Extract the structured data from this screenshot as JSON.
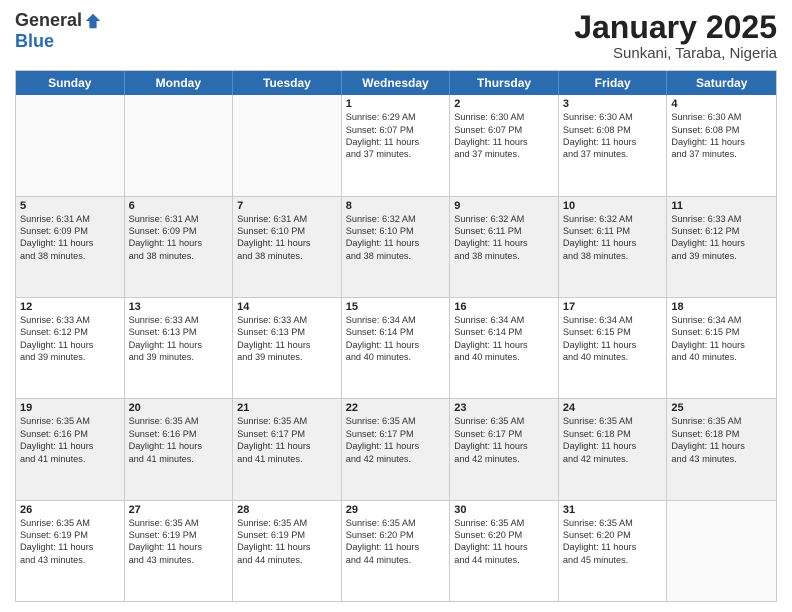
{
  "logo": {
    "general": "General",
    "blue": "Blue"
  },
  "title": "January 2025",
  "location": "Sunkani, Taraba, Nigeria",
  "days": [
    "Sunday",
    "Monday",
    "Tuesday",
    "Wednesday",
    "Thursday",
    "Friday",
    "Saturday"
  ],
  "rows": [
    [
      {
        "day": "",
        "lines": [],
        "empty": true
      },
      {
        "day": "",
        "lines": [],
        "empty": true
      },
      {
        "day": "",
        "lines": [],
        "empty": true
      },
      {
        "day": "1",
        "lines": [
          "Sunrise: 6:29 AM",
          "Sunset: 6:07 PM",
          "Daylight: 11 hours",
          "and 37 minutes."
        ],
        "empty": false
      },
      {
        "day": "2",
        "lines": [
          "Sunrise: 6:30 AM",
          "Sunset: 6:07 PM",
          "Daylight: 11 hours",
          "and 37 minutes."
        ],
        "empty": false
      },
      {
        "day": "3",
        "lines": [
          "Sunrise: 6:30 AM",
          "Sunset: 6:08 PM",
          "Daylight: 11 hours",
          "and 37 minutes."
        ],
        "empty": false
      },
      {
        "day": "4",
        "lines": [
          "Sunrise: 6:30 AM",
          "Sunset: 6:08 PM",
          "Daylight: 11 hours",
          "and 37 minutes."
        ],
        "empty": false
      }
    ],
    [
      {
        "day": "5",
        "lines": [
          "Sunrise: 6:31 AM",
          "Sunset: 6:09 PM",
          "Daylight: 11 hours",
          "and 38 minutes."
        ],
        "empty": false,
        "shaded": true
      },
      {
        "day": "6",
        "lines": [
          "Sunrise: 6:31 AM",
          "Sunset: 6:09 PM",
          "Daylight: 11 hours",
          "and 38 minutes."
        ],
        "empty": false,
        "shaded": true
      },
      {
        "day": "7",
        "lines": [
          "Sunrise: 6:31 AM",
          "Sunset: 6:10 PM",
          "Daylight: 11 hours",
          "and 38 minutes."
        ],
        "empty": false,
        "shaded": true
      },
      {
        "day": "8",
        "lines": [
          "Sunrise: 6:32 AM",
          "Sunset: 6:10 PM",
          "Daylight: 11 hours",
          "and 38 minutes."
        ],
        "empty": false,
        "shaded": true
      },
      {
        "day": "9",
        "lines": [
          "Sunrise: 6:32 AM",
          "Sunset: 6:11 PM",
          "Daylight: 11 hours",
          "and 38 minutes."
        ],
        "empty": false,
        "shaded": true
      },
      {
        "day": "10",
        "lines": [
          "Sunrise: 6:32 AM",
          "Sunset: 6:11 PM",
          "Daylight: 11 hours",
          "and 38 minutes."
        ],
        "empty": false,
        "shaded": true
      },
      {
        "day": "11",
        "lines": [
          "Sunrise: 6:33 AM",
          "Sunset: 6:12 PM",
          "Daylight: 11 hours",
          "and 39 minutes."
        ],
        "empty": false,
        "shaded": true
      }
    ],
    [
      {
        "day": "12",
        "lines": [
          "Sunrise: 6:33 AM",
          "Sunset: 6:12 PM",
          "Daylight: 11 hours",
          "and 39 minutes."
        ],
        "empty": false
      },
      {
        "day": "13",
        "lines": [
          "Sunrise: 6:33 AM",
          "Sunset: 6:13 PM",
          "Daylight: 11 hours",
          "and 39 minutes."
        ],
        "empty": false
      },
      {
        "day": "14",
        "lines": [
          "Sunrise: 6:33 AM",
          "Sunset: 6:13 PM",
          "Daylight: 11 hours",
          "and 39 minutes."
        ],
        "empty": false
      },
      {
        "day": "15",
        "lines": [
          "Sunrise: 6:34 AM",
          "Sunset: 6:14 PM",
          "Daylight: 11 hours",
          "and 40 minutes."
        ],
        "empty": false
      },
      {
        "day": "16",
        "lines": [
          "Sunrise: 6:34 AM",
          "Sunset: 6:14 PM",
          "Daylight: 11 hours",
          "and 40 minutes."
        ],
        "empty": false
      },
      {
        "day": "17",
        "lines": [
          "Sunrise: 6:34 AM",
          "Sunset: 6:15 PM",
          "Daylight: 11 hours",
          "and 40 minutes."
        ],
        "empty": false
      },
      {
        "day": "18",
        "lines": [
          "Sunrise: 6:34 AM",
          "Sunset: 6:15 PM",
          "Daylight: 11 hours",
          "and 40 minutes."
        ],
        "empty": false
      }
    ],
    [
      {
        "day": "19",
        "lines": [
          "Sunrise: 6:35 AM",
          "Sunset: 6:16 PM",
          "Daylight: 11 hours",
          "and 41 minutes."
        ],
        "empty": false,
        "shaded": true
      },
      {
        "day": "20",
        "lines": [
          "Sunrise: 6:35 AM",
          "Sunset: 6:16 PM",
          "Daylight: 11 hours",
          "and 41 minutes."
        ],
        "empty": false,
        "shaded": true
      },
      {
        "day": "21",
        "lines": [
          "Sunrise: 6:35 AM",
          "Sunset: 6:17 PM",
          "Daylight: 11 hours",
          "and 41 minutes."
        ],
        "empty": false,
        "shaded": true
      },
      {
        "day": "22",
        "lines": [
          "Sunrise: 6:35 AM",
          "Sunset: 6:17 PM",
          "Daylight: 11 hours",
          "and 42 minutes."
        ],
        "empty": false,
        "shaded": true
      },
      {
        "day": "23",
        "lines": [
          "Sunrise: 6:35 AM",
          "Sunset: 6:17 PM",
          "Daylight: 11 hours",
          "and 42 minutes."
        ],
        "empty": false,
        "shaded": true
      },
      {
        "day": "24",
        "lines": [
          "Sunrise: 6:35 AM",
          "Sunset: 6:18 PM",
          "Daylight: 11 hours",
          "and 42 minutes."
        ],
        "empty": false,
        "shaded": true
      },
      {
        "day": "25",
        "lines": [
          "Sunrise: 6:35 AM",
          "Sunset: 6:18 PM",
          "Daylight: 11 hours",
          "and 43 minutes."
        ],
        "empty": false,
        "shaded": true
      }
    ],
    [
      {
        "day": "26",
        "lines": [
          "Sunrise: 6:35 AM",
          "Sunset: 6:19 PM",
          "Daylight: 11 hours",
          "and 43 minutes."
        ],
        "empty": false
      },
      {
        "day": "27",
        "lines": [
          "Sunrise: 6:35 AM",
          "Sunset: 6:19 PM",
          "Daylight: 11 hours",
          "and 43 minutes."
        ],
        "empty": false
      },
      {
        "day": "28",
        "lines": [
          "Sunrise: 6:35 AM",
          "Sunset: 6:19 PM",
          "Daylight: 11 hours",
          "and 44 minutes."
        ],
        "empty": false
      },
      {
        "day": "29",
        "lines": [
          "Sunrise: 6:35 AM",
          "Sunset: 6:20 PM",
          "Daylight: 11 hours",
          "and 44 minutes."
        ],
        "empty": false
      },
      {
        "day": "30",
        "lines": [
          "Sunrise: 6:35 AM",
          "Sunset: 6:20 PM",
          "Daylight: 11 hours",
          "and 44 minutes."
        ],
        "empty": false
      },
      {
        "day": "31",
        "lines": [
          "Sunrise: 6:35 AM",
          "Sunset: 6:20 PM",
          "Daylight: 11 hours",
          "and 45 minutes."
        ],
        "empty": false
      },
      {
        "day": "",
        "lines": [],
        "empty": true
      }
    ]
  ]
}
